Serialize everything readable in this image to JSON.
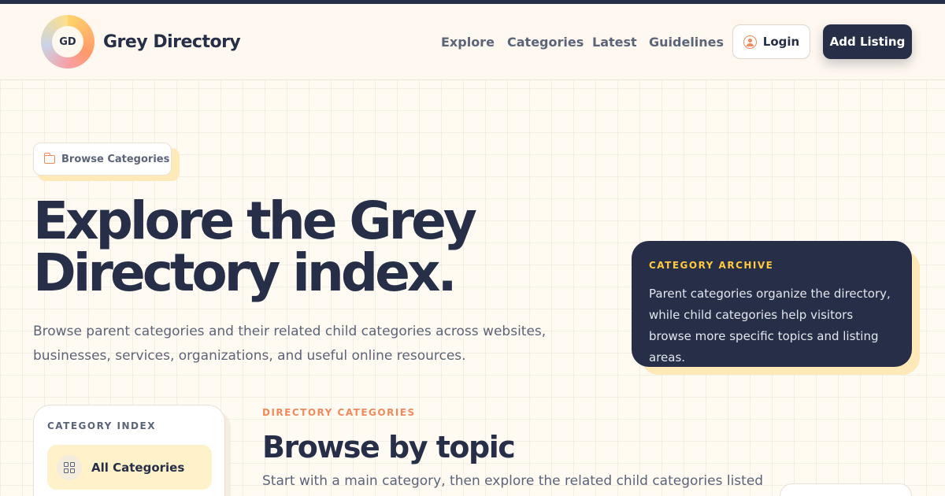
{
  "header": {
    "logo_text": "GD",
    "brand": "Grey Directory",
    "nav": [
      "Explore",
      "Categories",
      "Latest",
      "Guidelines"
    ],
    "login_label": "Login",
    "add_listing_label": "Add Listing"
  },
  "hero": {
    "pill_label": "Browse Categories",
    "title": "Explore the Grey Directory index.",
    "subtitle": "Browse parent categories and their related child categories across websites, businesses, services, organizations, and useful online resources."
  },
  "archive": {
    "label": "CATEGORY ARCHIVE",
    "text": "Parent categories organize the directory, while child categories help visitors browse more specific topics and listing areas."
  },
  "sidebar": {
    "label": "CATEGORY INDEX",
    "all_categories": "All Categories"
  },
  "section": {
    "eyebrow": "DIRECTORY CATEGORIES",
    "title": "Browse by topic",
    "subtitle": "Start with a main category, then explore the related child categories listed"
  },
  "colors": {
    "navy": "#262f47",
    "accent_orange": "#f08a5d",
    "accent_yellow": "#ffc940",
    "background": "#fffaf2"
  },
  "icons": {
    "login": "user-icon",
    "pill": "folder-icon",
    "all_categories": "grid-icon"
  }
}
